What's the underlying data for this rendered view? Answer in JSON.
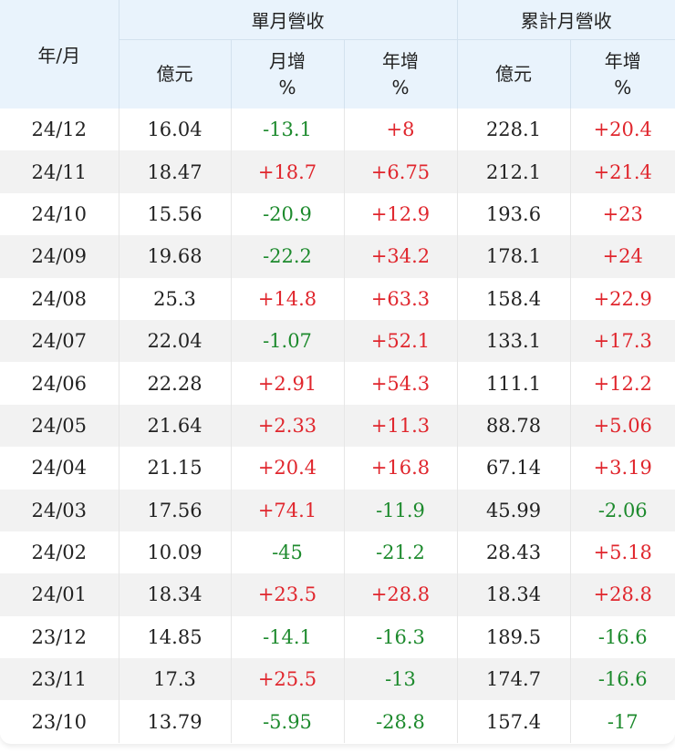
{
  "table": {
    "headers": {
      "period": "年/月",
      "monthly_group": "單月營收",
      "cumulative_group": "累計月營收",
      "amount": "億元",
      "mom_label": "月增",
      "yoy_label": "年增",
      "percent_unit": "%"
    },
    "rows": [
      {
        "period": "24/12",
        "monthly": "16.04",
        "mom": "-13.1",
        "yoy": "+8",
        "cumulative": "228.1",
        "cum_yoy": "+20.4"
      },
      {
        "period": "24/11",
        "monthly": "18.47",
        "mom": "+18.7",
        "yoy": "+6.75",
        "cumulative": "212.1",
        "cum_yoy": "+21.4"
      },
      {
        "period": "24/10",
        "monthly": "15.56",
        "mom": "-20.9",
        "yoy": "+12.9",
        "cumulative": "193.6",
        "cum_yoy": "+23"
      },
      {
        "period": "24/09",
        "monthly": "19.68",
        "mom": "-22.2",
        "yoy": "+34.2",
        "cumulative": "178.1",
        "cum_yoy": "+24"
      },
      {
        "period": "24/08",
        "monthly": "25.3",
        "mom": "+14.8",
        "yoy": "+63.3",
        "cumulative": "158.4",
        "cum_yoy": "+22.9"
      },
      {
        "period": "24/07",
        "monthly": "22.04",
        "mom": "-1.07",
        "yoy": "+52.1",
        "cumulative": "133.1",
        "cum_yoy": "+17.3"
      },
      {
        "period": "24/06",
        "monthly": "22.28",
        "mom": "+2.91",
        "yoy": "+54.3",
        "cumulative": "111.1",
        "cum_yoy": "+12.2"
      },
      {
        "period": "24/05",
        "monthly": "21.64",
        "mom": "+2.33",
        "yoy": "+11.3",
        "cumulative": "88.78",
        "cum_yoy": "+5.06"
      },
      {
        "period": "24/04",
        "monthly": "21.15",
        "mom": "+20.4",
        "yoy": "+16.8",
        "cumulative": "67.14",
        "cum_yoy": "+3.19"
      },
      {
        "period": "24/03",
        "monthly": "17.56",
        "mom": "+74.1",
        "yoy": "-11.9",
        "cumulative": "45.99",
        "cum_yoy": "-2.06"
      },
      {
        "period": "24/02",
        "monthly": "10.09",
        "mom": "-45",
        "yoy": "-21.2",
        "cumulative": "28.43",
        "cum_yoy": "+5.18"
      },
      {
        "period": "24/01",
        "monthly": "18.34",
        "mom": "+23.5",
        "yoy": "+28.8",
        "cumulative": "18.34",
        "cum_yoy": "+28.8"
      },
      {
        "period": "23/12",
        "monthly": "14.85",
        "mom": "-14.1",
        "yoy": "-16.3",
        "cumulative": "189.5",
        "cum_yoy": "-16.6"
      },
      {
        "period": "23/11",
        "monthly": "17.3",
        "mom": "+25.5",
        "yoy": "-13",
        "cumulative": "174.7",
        "cum_yoy": "-16.6"
      },
      {
        "period": "23/10",
        "monthly": "13.79",
        "mom": "-5.95",
        "yoy": "-28.8",
        "cumulative": "157.4",
        "cum_yoy": "-17"
      }
    ]
  },
  "colors": {
    "positive": "#e0262d",
    "negative": "#1d8a2d",
    "header_bg": "#e9f3fc",
    "stripe_bg": "#f2f2f2"
  }
}
